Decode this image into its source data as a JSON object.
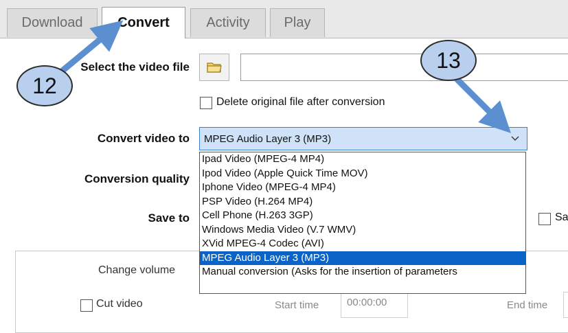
{
  "tabs": [
    {
      "label": "Download"
    },
    {
      "label": "Convert"
    },
    {
      "label": "Activity"
    },
    {
      "label": "Play"
    }
  ],
  "form": {
    "select_video_label": "Select the video file",
    "file_path_value": "",
    "delete_original_label": "Delete original file after conversion",
    "convert_to_label": "Convert video to",
    "convert_to_value": "MPEG Audio Layer 3 (MP3)",
    "quality_label": "Conversion quality",
    "save_to_label": "Save to",
    "save_checkbox_label": "Sa"
  },
  "dropdown": {
    "options": [
      "Ipad Video (MPEG-4 MP4)",
      "Ipod Video (Apple Quick Time MOV)",
      "Iphone Video (MPEG-4 MP4)",
      "PSP Video (H.264 MP4)",
      "Cell Phone (H.263 3GP)",
      "Windows Media Video (V.7 WMV)",
      "XVid MPEG-4 Codec (AVI)",
      "MPEG Audio Layer 3 (MP3)",
      "Manual conversion (Asks for the insertion of parameters"
    ],
    "selected_index": 7
  },
  "group": {
    "change_volume_label": "Change volume",
    "cut_video_label": "Cut video",
    "start_time_label": "Start time",
    "start_time_value": "00:00:00",
    "end_time_label": "End time"
  },
  "annotations": {
    "callout_12": "12",
    "callout_13": "13"
  },
  "colors": {
    "callout_fill": "#b9cfee",
    "arrow": "#5b8fd0",
    "selected_bg": "#0a64c8",
    "select_bg": "#cfe2f7"
  }
}
